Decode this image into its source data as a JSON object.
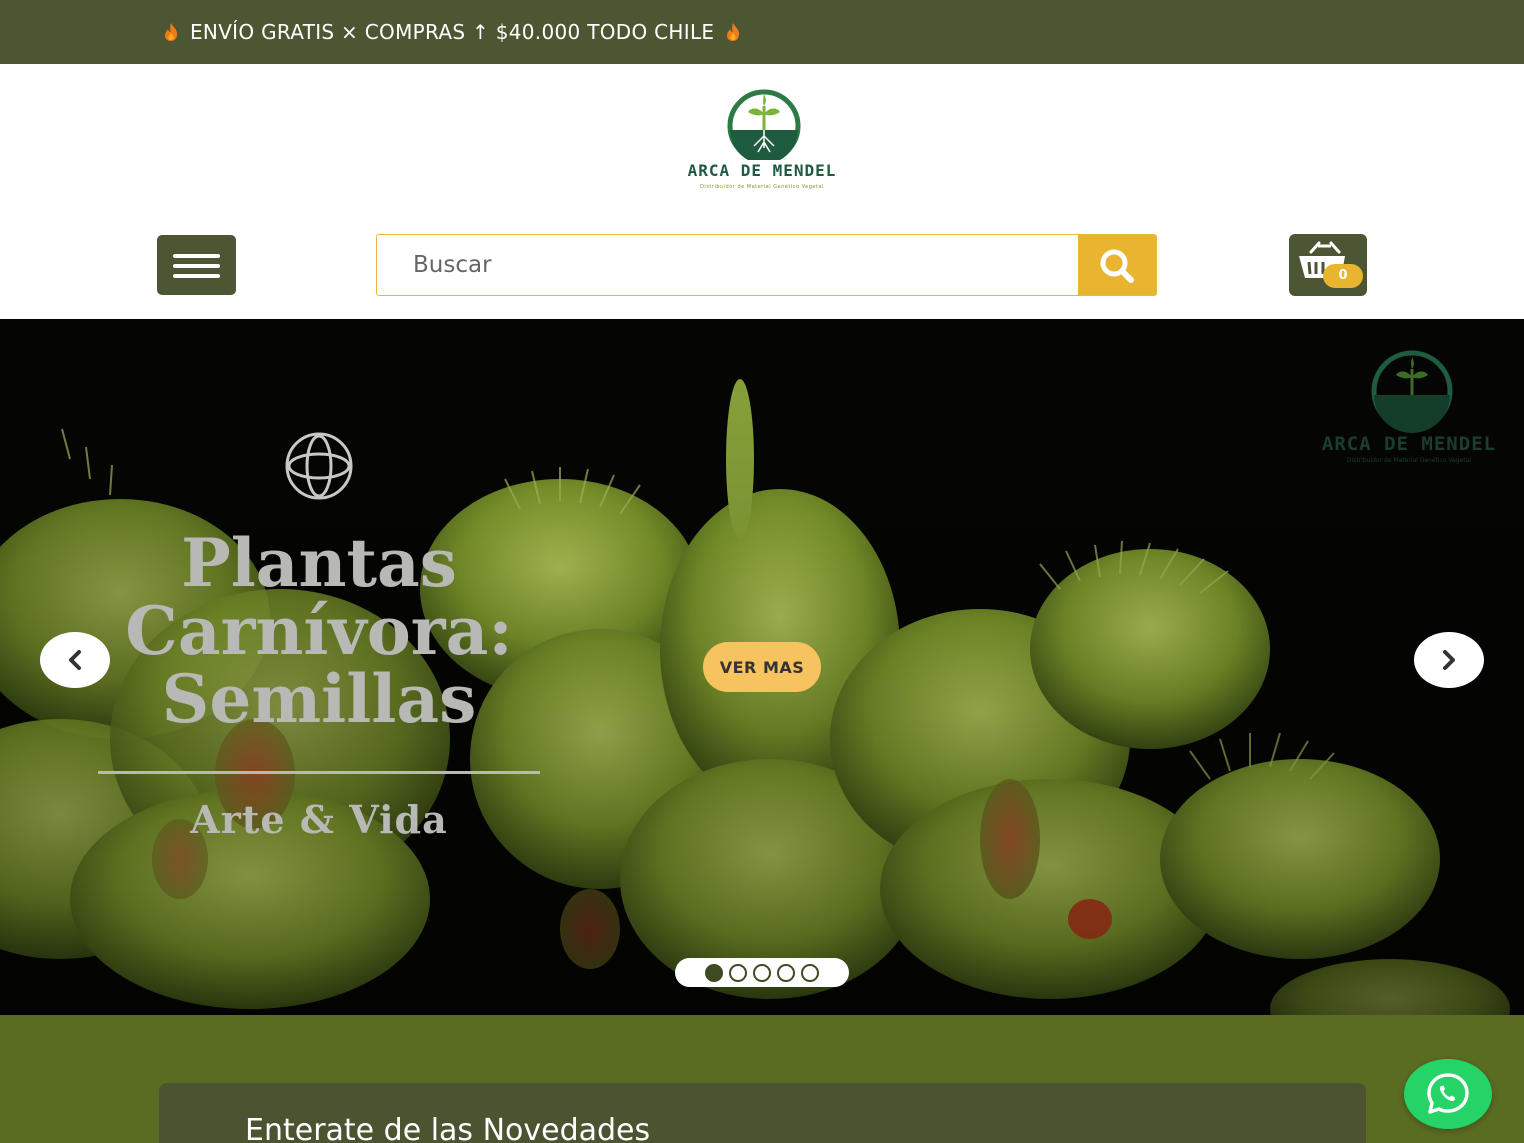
{
  "promo": {
    "text": "ENVÍO GRATIS × COMPRAS ↑ $40.000 TODO CHILE",
    "flame_icon": "flame-icon"
  },
  "header": {
    "logo": {
      "name": "ARCA DE MENDEL",
      "tagline": "Distribuidor de Material Genético Vegetal"
    },
    "menu_icon": "hamburger-icon",
    "search": {
      "placeholder": "Buscar",
      "value": "",
      "icon": "search-icon"
    },
    "cart": {
      "icon": "basket-icon",
      "count": "0"
    }
  },
  "hero": {
    "title": "Plantas Carnívora: Semillas",
    "title_lines": [
      "Plantas",
      "Carnívora:",
      "Semillas"
    ],
    "subtitle": "Arte & Vida",
    "button_label": "VER MAS",
    "logo_name": "ARCA DE MENDEL",
    "logo_tagline": "Distribuidor de Material Genético Vegetal",
    "slides_total": 5,
    "active_slide": 1,
    "prev_icon": "chevron-left-icon",
    "next_icon": "chevron-right-icon"
  },
  "newsletter": {
    "title": "Enterate de las Novedades"
  },
  "whatsapp": {
    "icon": "whatsapp-icon"
  },
  "colors": {
    "brand_dark": "#4d5632",
    "accent_yellow": "#e9b531",
    "hero_button": "#f6c35e",
    "band_green": "#5a6b22",
    "whatsapp_green": "#25d366"
  }
}
